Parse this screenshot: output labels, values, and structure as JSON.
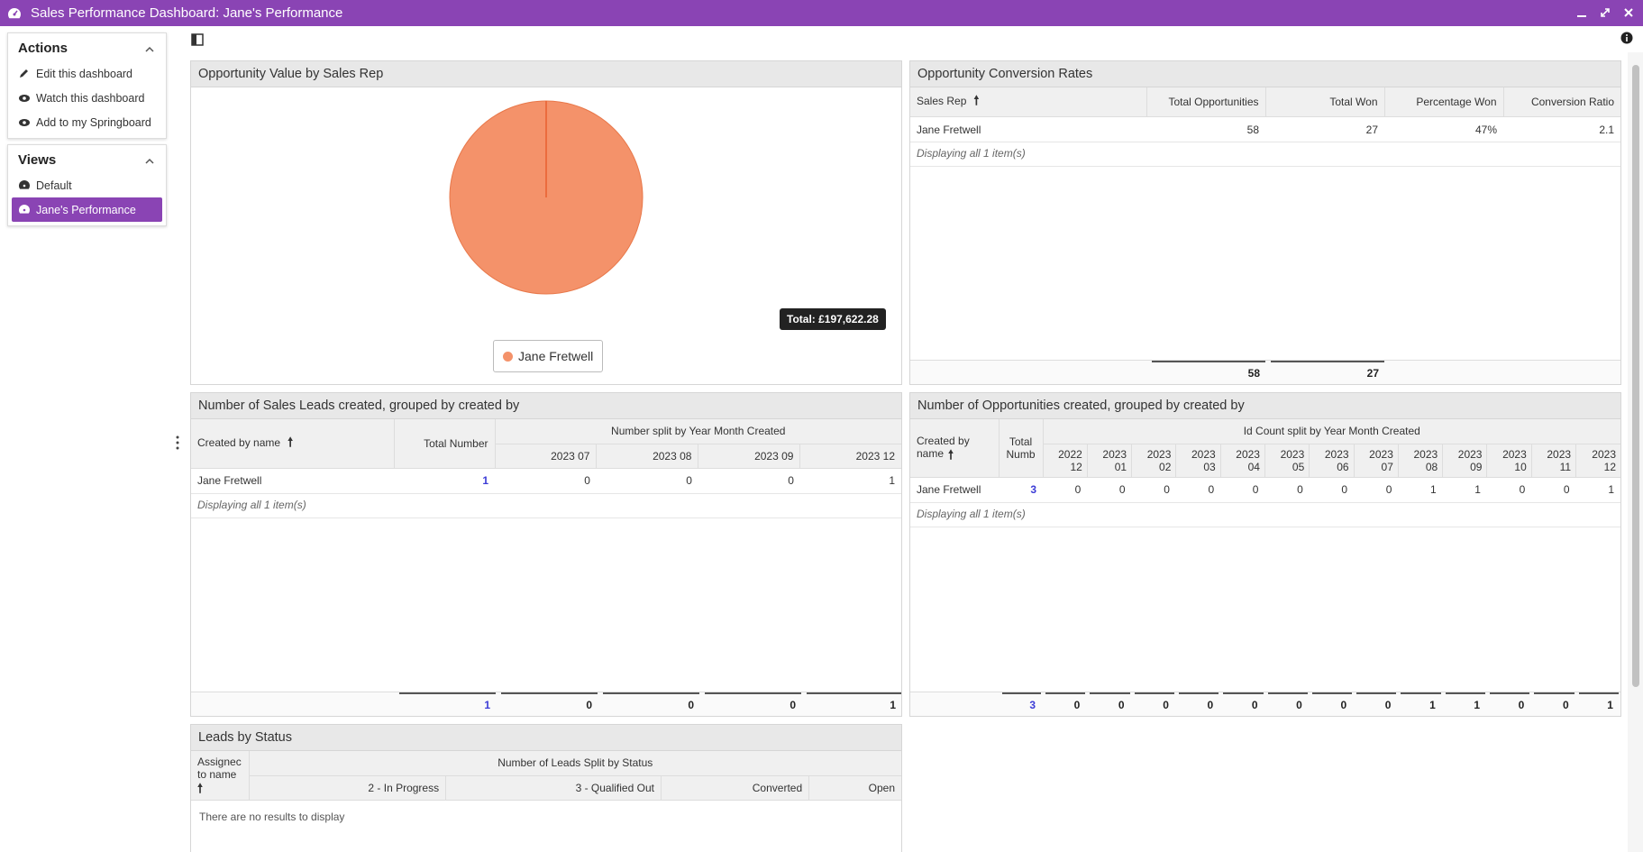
{
  "window": {
    "title": "Sales Performance Dashboard: Jane's Performance",
    "accent": "#8a44b4"
  },
  "sidebar": {
    "actions": {
      "title": "Actions",
      "items": [
        {
          "label": "Edit this dashboard",
          "icon": "pencil-icon"
        },
        {
          "label": "Watch this dashboard",
          "icon": "eye-icon"
        },
        {
          "label": "Add to my Springboard",
          "icon": "eye-icon"
        }
      ]
    },
    "views": {
      "title": "Views",
      "items": [
        {
          "label": "Default",
          "icon": "dashboard-icon",
          "active": false
        },
        {
          "label": "Jane's Performance",
          "icon": "dashboard-icon",
          "active": true
        }
      ]
    }
  },
  "widgets": {
    "opp_value": {
      "title": "Opportunity Value by Sales Rep",
      "total": "Total: £197,622.28",
      "legend": "Jane Fretwell",
      "color": "#f4926a",
      "chart_data": {
        "type": "pie",
        "categories": [
          "Jane Fretwell"
        ],
        "values": [
          197622.28
        ],
        "title": "Opportunity Value by Sales Rep"
      }
    },
    "conversion": {
      "title": "Opportunity Conversion Rates",
      "headers": [
        "Sales Rep",
        "Total Opportunities",
        "Total Won",
        "Percentage Won",
        "Conversion Ratio"
      ],
      "row": [
        "Jane Fretwell",
        "58",
        "27",
        "47%",
        "2.1"
      ],
      "displaying": "Displaying all 1 item(s)",
      "footer": [
        "58",
        "27"
      ]
    },
    "leads": {
      "title": "Number of Sales Leads created, grouped by created by",
      "col_name": "Created by name",
      "col_total": "Total Number",
      "group_header": "Number split by Year Month Created",
      "months": [
        "2023 07",
        "2023 08",
        "2023 09",
        "2023 12"
      ],
      "row": {
        "name": "Jane Fretwell",
        "total": "1",
        "values": [
          "0",
          "0",
          "0",
          "1"
        ]
      },
      "displaying": "Displaying all 1 item(s)",
      "footer": [
        "1",
        "0",
        "0",
        "0",
        "1"
      ]
    },
    "opps_created": {
      "title": "Number of Opportunities created, grouped by created by",
      "col_name_1": "Created by",
      "col_name_2": "name",
      "col_total_1": "Total",
      "col_total_2": "Numb",
      "group_header": "Id Count split by Year Month Created",
      "months": [
        [
          "2022",
          "12"
        ],
        [
          "2023",
          "01"
        ],
        [
          "2023",
          "02"
        ],
        [
          "2023",
          "03"
        ],
        [
          "2023",
          "04"
        ],
        [
          "2023",
          "05"
        ],
        [
          "2023",
          "06"
        ],
        [
          "2023",
          "07"
        ],
        [
          "2023",
          "08"
        ],
        [
          "2023",
          "09"
        ],
        [
          "2023",
          "10"
        ],
        [
          "2023",
          "11"
        ],
        [
          "2023",
          "12"
        ]
      ],
      "row": {
        "name": "Jane Fretwell",
        "total": "3",
        "values": [
          "0",
          "0",
          "0",
          "0",
          "0",
          "0",
          "0",
          "0",
          "1",
          "1",
          "0",
          "0",
          "1"
        ]
      },
      "displaying": "Displaying all 1 item(s)",
      "footer": [
        "3",
        "0",
        "0",
        "0",
        "0",
        "0",
        "0",
        "0",
        "0",
        "1",
        "1",
        "0",
        "0",
        "1"
      ]
    },
    "leads_status": {
      "title": "Leads by Status",
      "col_name_1": "Assignec",
      "col_name_2": "to name",
      "group_header": "Number of Leads Split by Status",
      "statuses": [
        "2 - In Progress",
        "3 - Qualified Out",
        "Converted",
        "Open"
      ],
      "empty": "There are no results to display"
    }
  }
}
